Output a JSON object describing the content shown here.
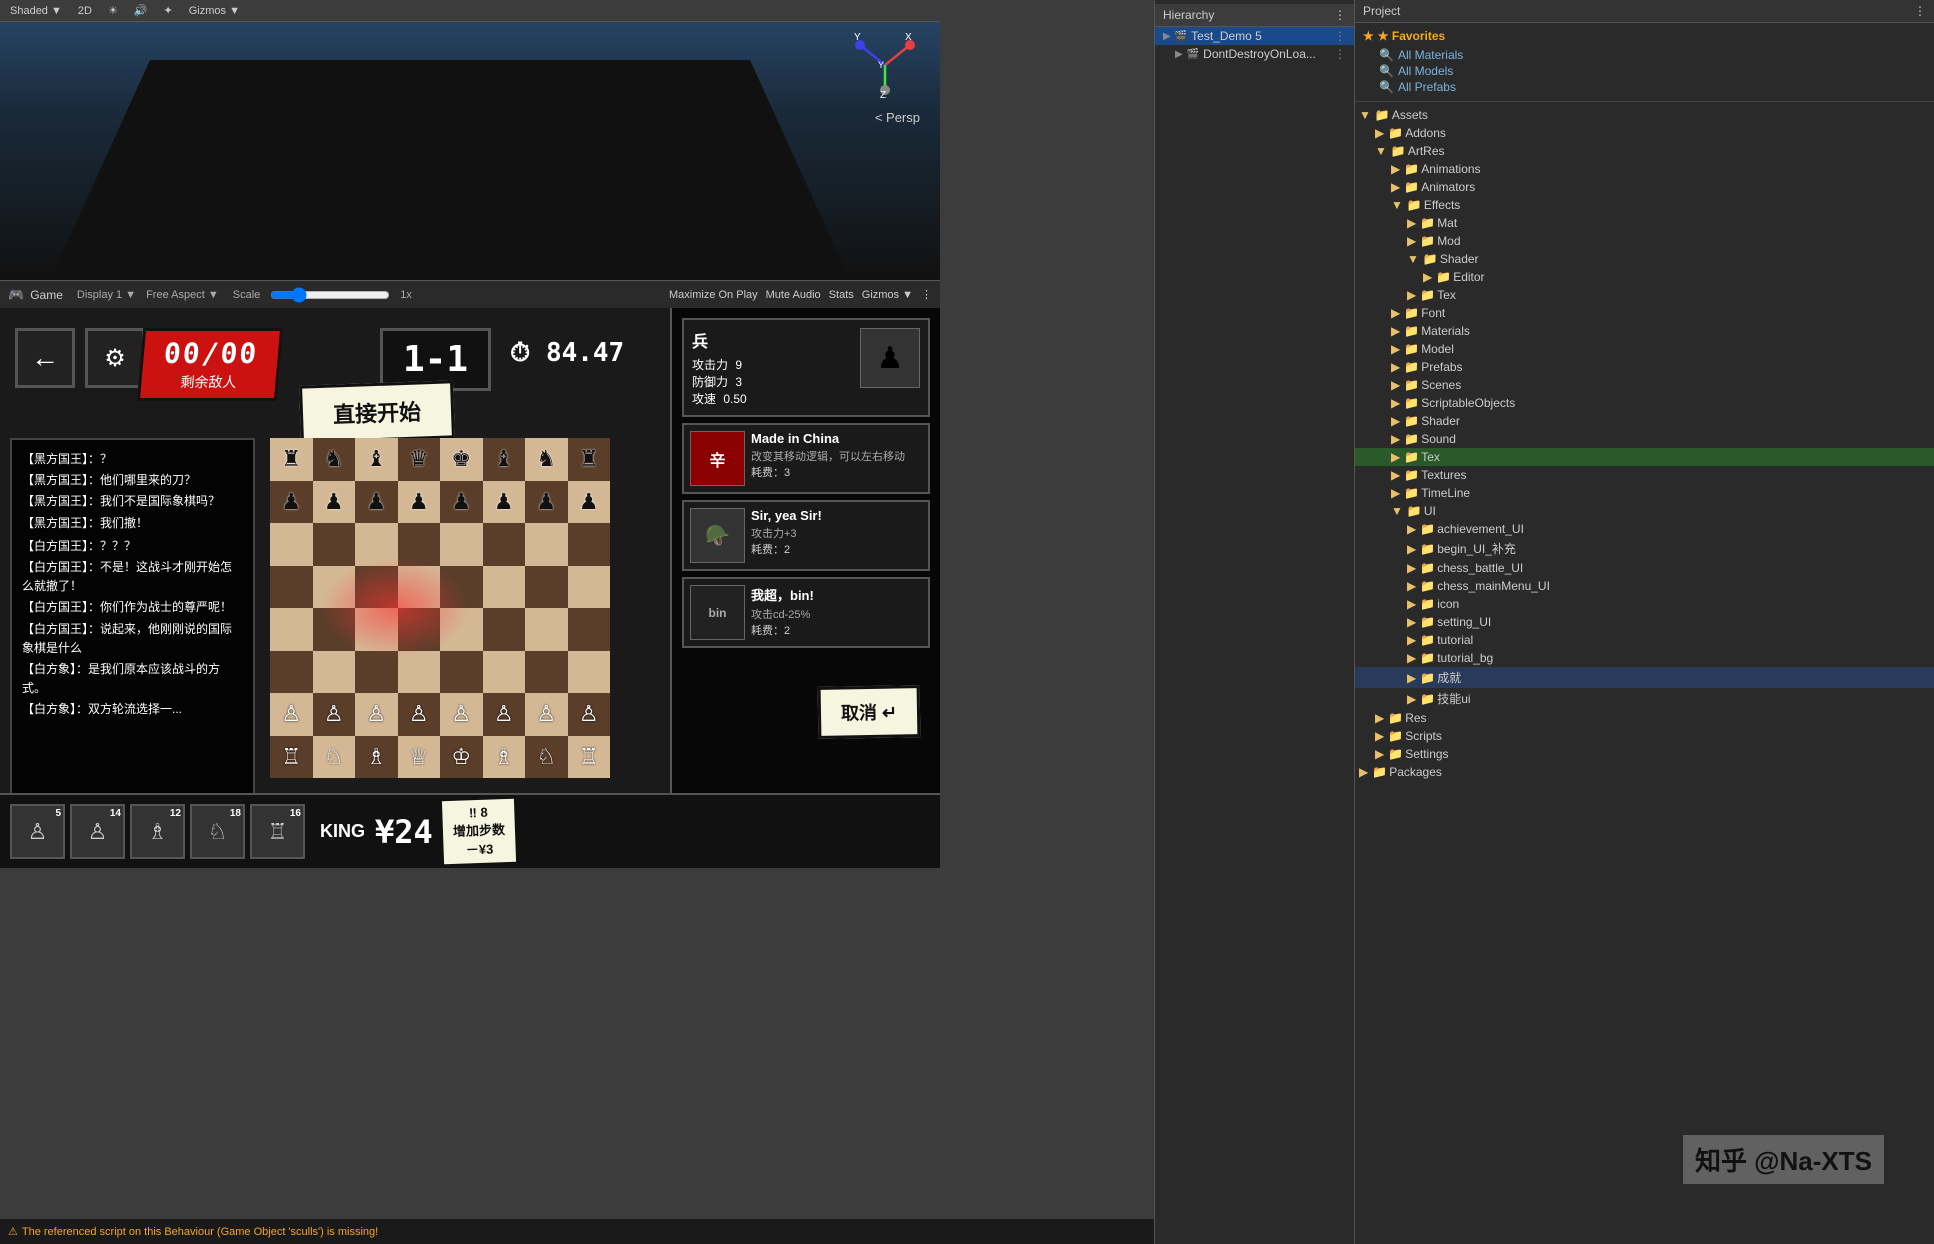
{
  "scene": {
    "label": "Shaded",
    "persp_label": "< Persp",
    "toolbar_items": [
      "Shaded",
      "2D",
      "Lighting",
      "Audio",
      "FX",
      "Gizmos"
    ]
  },
  "game_panel": {
    "title": "Game",
    "display": "Display 1",
    "aspect": "Free Aspect",
    "scale_label": "Scale",
    "scale_value": "1x",
    "controls": [
      "Maximize On Play",
      "Mute Audio",
      "Stats",
      "Gizmos"
    ]
  },
  "game_ui": {
    "score": "00/00",
    "enemy_label": "剩余敌人",
    "level": "1-1",
    "timer_icon": "⏱",
    "timer_value": "84.47",
    "start_btn": "直接开始",
    "dialogue": [
      "【黑方国王】：？",
      "【黑方国王】：他们哪里来的刀？",
      "【黑方国王】：我们不是国际象棋吗？",
      "【黑方国王】：我们撤！",
      "",
      "【白方国王】：？？？",
      "【白方国王】：不是！这战斗才刚开始怎么就撤了！",
      "【白方国王】：你们作为战士的尊严呢！",
      "【白方国王】：说起来，他刚刚说的国际象棋是什么",
      "【白方象】：是我们原本应该战斗的方式。",
      "【白方象】：双方轮流选择一..."
    ],
    "piece_name": "兵",
    "piece_stats": {
      "attack_label": "攻击力",
      "attack_value": "9",
      "defense_label": "防御力",
      "defense_value": "3",
      "speed_label": "攻速",
      "speed_value": "0.50"
    },
    "skills": [
      {
        "name": "Made in China",
        "desc": "改变其移动逻辑，可以左右移动",
        "cost_label": "耗费",
        "cost": "3",
        "emoji": "辛"
      },
      {
        "name": "Sir, yea Sir!",
        "desc": "攻击力+3",
        "cost_label": "耗费",
        "cost": "2",
        "emoji": "🪖"
      },
      {
        "name": "我超，bin!",
        "desc": "攻击cd-25%",
        "cost_label": "耗费",
        "cost": "2",
        "emoji": "bin"
      }
    ],
    "cancel_btn": "取消 ↵",
    "bottom_pieces": [
      {
        "count": "5",
        "emoji": "♙"
      },
      {
        "count": "14",
        "emoji": "♙"
      },
      {
        "count": "12",
        "emoji": "♗"
      },
      {
        "count": "18",
        "emoji": "♘"
      },
      {
        "count": "16",
        "emoji": "♖"
      }
    ],
    "king_label": "KING",
    "money": "¥24",
    "step_count": "‼ 8",
    "step_label": "增加步数",
    "step_cost": "－¥3"
  },
  "status_bar": {
    "text": "The referenced script on this Behaviour (Game Object 'sculls') is missing!"
  },
  "hierarchy": {
    "title": "Test_Demo 5",
    "items": [
      {
        "label": "Test_Demo 5",
        "level": 0,
        "icon": "▶"
      },
      {
        "label": "DontDestroyOnLoa...",
        "level": 0,
        "icon": "▶"
      }
    ]
  },
  "project": {
    "favorites": {
      "title": "★ Favorites",
      "items": [
        "🔍 All Materials",
        "🔍 All Models",
        "🔍 All Prefabs"
      ]
    },
    "assets": {
      "title": "Assets",
      "children": [
        {
          "label": "Addons",
          "level": 1,
          "type": "folder"
        },
        {
          "label": "ArtRes",
          "level": 1,
          "type": "folder",
          "expanded": true,
          "children": [
            {
              "label": "Animations",
              "level": 2,
              "type": "folder"
            },
            {
              "label": "Animators",
              "level": 2,
              "type": "folder"
            },
            {
              "label": "Effects",
              "level": 2,
              "type": "folder",
              "expanded": true,
              "children": [
                {
                  "label": "Mat",
                  "level": 3,
                  "type": "folder"
                },
                {
                  "label": "Mod",
                  "level": 3,
                  "type": "folder"
                },
                {
                  "label": "Shader",
                  "level": 3,
                  "type": "folder",
                  "expanded": true,
                  "children": [
                    {
                      "label": "Editor",
                      "level": 4,
                      "type": "folder"
                    }
                  ]
                },
                {
                  "label": "Tex",
                  "level": 3,
                  "type": "folder"
                }
              ]
            },
            {
              "label": "Font",
              "level": 2,
              "type": "folder"
            },
            {
              "label": "Materials",
              "level": 2,
              "type": "folder"
            },
            {
              "label": "Model",
              "level": 2,
              "type": "folder"
            },
            {
              "label": "Prefabs",
              "level": 2,
              "type": "folder"
            },
            {
              "label": "Scenes",
              "level": 2,
              "type": "folder"
            },
            {
              "label": "ScriptableObjects",
              "level": 2,
              "type": "folder"
            },
            {
              "label": "Shader",
              "level": 2,
              "type": "folder"
            },
            {
              "label": "Sound",
              "level": 2,
              "type": "folder"
            },
            {
              "label": "Tex",
              "level": 2,
              "type": "folder",
              "selected": true
            },
            {
              "label": "Textures",
              "level": 2,
              "type": "folder"
            },
            {
              "label": "TimeLine",
              "level": 2,
              "type": "folder"
            },
            {
              "label": "UI",
              "level": 2,
              "type": "folder",
              "expanded": true,
              "children": [
                {
                  "label": "achievement_UI",
                  "level": 3,
                  "type": "folder"
                },
                {
                  "label": "begin_UI_补充",
                  "level": 3,
                  "type": "folder"
                },
                {
                  "label": "chess_battle_UI",
                  "level": 3,
                  "type": "folder"
                },
                {
                  "label": "chess_mainMenu_UI",
                  "level": 3,
                  "type": "folder"
                },
                {
                  "label": "icon",
                  "level": 3,
                  "type": "folder"
                },
                {
                  "label": "setting_UI",
                  "level": 3,
                  "type": "folder"
                },
                {
                  "label": "tutorial",
                  "level": 3,
                  "type": "folder"
                },
                {
                  "label": "tutorial_bg",
                  "level": 3,
                  "type": "folder"
                },
                {
                  "label": "成就",
                  "level": 3,
                  "type": "folder"
                },
                {
                  "label": "技能ui",
                  "level": 3,
                  "type": "folder"
                }
              ]
            }
          ]
        },
        {
          "label": "Res",
          "level": 1,
          "type": "folder"
        },
        {
          "label": "Scripts",
          "level": 1,
          "type": "folder"
        },
        {
          "label": "Settings",
          "level": 1,
          "type": "folder"
        }
      ]
    },
    "packages": {
      "label": "Packages",
      "level": 0,
      "type": "folder"
    }
  },
  "watermark": "知乎 @Na-XTS",
  "icons": {
    "back": "←",
    "settings": "⚙",
    "folder": "📁",
    "search": "🔍",
    "star": "★",
    "triangle_right": "▶",
    "triangle_down": "▼",
    "gear": "⚙",
    "more": "⋮"
  }
}
